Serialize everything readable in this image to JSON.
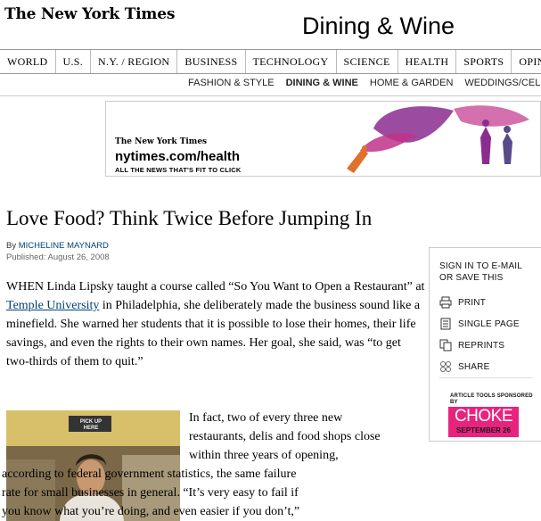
{
  "header": {
    "logo": "The New York Times",
    "section_title": "Dining & Wine"
  },
  "nav": {
    "items": [
      "WORLD",
      "U.S.",
      "N.Y. / REGION",
      "BUSINESS",
      "TECHNOLOGY",
      "SCIENCE",
      "HEALTH",
      "SPORTS",
      "OPINION"
    ]
  },
  "subnav": {
    "items": [
      "FASHION & STYLE",
      "DINING & WINE",
      "HOME & GARDEN",
      "WEDDINGS/CEL"
    ],
    "active": "DINING & WINE"
  },
  "ad": {
    "logo": "The New York Times",
    "url": "nytimes.com/health",
    "tagline": "ALL THE NEWS THAT'S FIT TO CLICK",
    "colors": {
      "purple": "#8a2d8f",
      "magenta": "#c0338a",
      "orange": "#e0702a"
    }
  },
  "article": {
    "headline": "Love Food? Think Twice Before Jumping In",
    "byline_prefix": "By ",
    "author": "MICHELINE MAYNARD",
    "published": "Published: August 26, 2008",
    "para1_a": "WHEN Linda Lipsky taught a course called “So You Want to Open a Restaurant” at ",
    "para1_link": "Temple University",
    "para1_b": " in Philadelphia, she deliberately made the business sound like a minefield. She warned her students that it is possible to lose their homes, their life savings, and even the rights to their own names. Her goal, she said, was “to get two-thirds of them to quit.”",
    "para2_lines": [
      "In fact, two of every three new",
      "restaurants, delis and food shops close",
      "within three years of opening,",
      "according to federal government statistics, the same failure",
      "rate for small businesses in general. “It’s very easy to fail if",
      "you know what you’re doing, and even easier if you don’t,”"
    ],
    "photo_sign": "PICK UP HERE"
  },
  "tools": {
    "signin": "SIGN IN TO E-MAIL OR SAVE THIS",
    "items": [
      {
        "label": "PRINT",
        "icon": "print-icon"
      },
      {
        "label": "SINGLE PAGE",
        "icon": "single-page-icon"
      },
      {
        "label": "REPRINTS",
        "icon": "reprints-icon"
      },
      {
        "label": "SHARE",
        "icon": "share-icon"
      }
    ],
    "sponsor_label": "ARTICLE TOOLS SPONSORED BY",
    "sponsor_name": "CHOKE",
    "sponsor_date": "SEPTEMBER 26",
    "sponsor_color": "#e8237d"
  }
}
